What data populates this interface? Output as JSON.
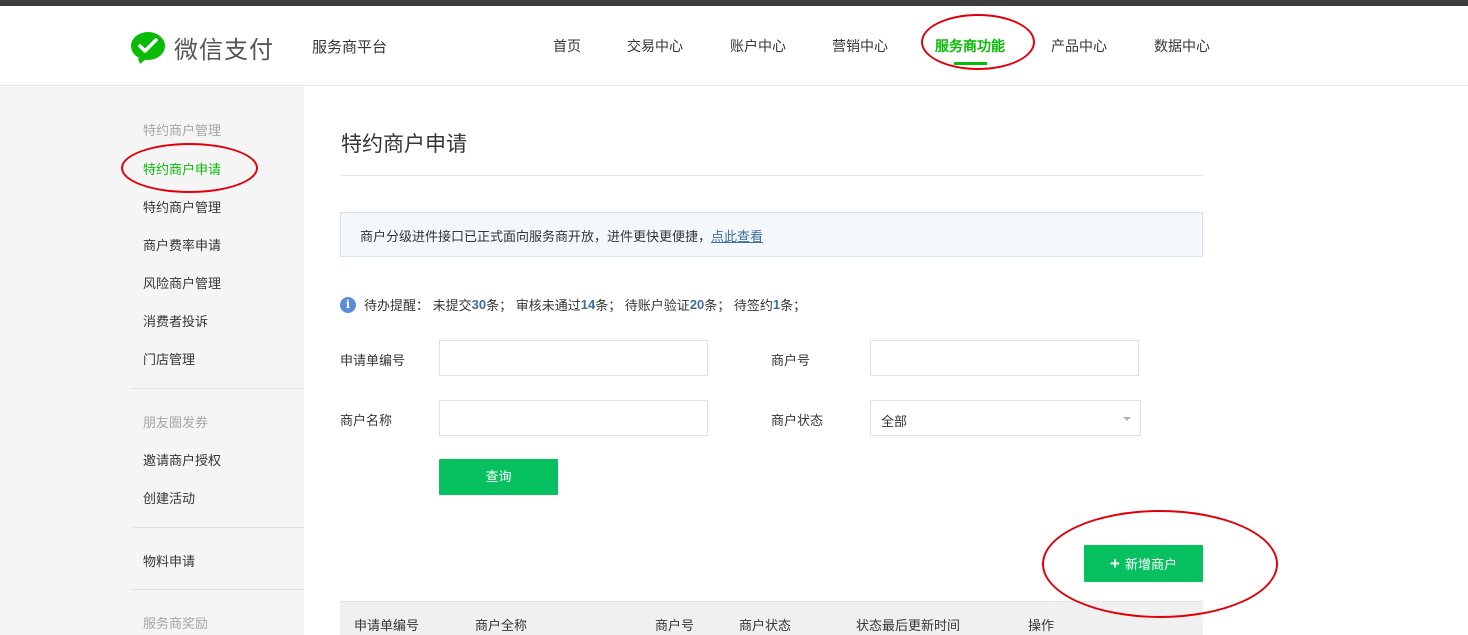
{
  "header": {
    "logo_text": "微信支付",
    "platform": "服务商平台",
    "nav": [
      {
        "label": "首页"
      },
      {
        "label": "交易中心"
      },
      {
        "label": "账户中心"
      },
      {
        "label": "营销中心"
      },
      {
        "label": "服务商功能",
        "active": true
      },
      {
        "label": "产品中心"
      },
      {
        "label": "数据中心"
      }
    ]
  },
  "sidebar": {
    "group1_title": "特约商户管理",
    "group1_items": [
      "特约商户申请",
      "特约商户管理",
      "商户费率申请",
      "风险商户管理",
      "消费者投诉",
      "门店管理"
    ],
    "group2_title": "朋友圈发券",
    "group2_items": [
      "邀请商户授权",
      "创建活动"
    ],
    "group3_items": [
      "物料申请"
    ],
    "group4_title": "服务商奖励"
  },
  "main": {
    "title": "特约商户申请",
    "notice_text": "商户分级进件接口已正式面向服务商开放，进件更快更便捷，",
    "notice_link": "点此查看",
    "todo": {
      "prefix": "待办提醒： 未提交",
      "n1": "30",
      "t1": "条； 审核未通过",
      "n2": "14",
      "t2": "条； 待账户验证",
      "n3": "20",
      "t3": "条； 待签约",
      "n4": "1",
      "t4": "条；"
    },
    "form": {
      "app_no_label": "申请单编号",
      "app_no_value": "",
      "merchant_no_label": "商户号",
      "merchant_no_value": "",
      "merchant_name_label": "商户名称",
      "merchant_name_value": "",
      "status_label": "商户状态",
      "status_value": "全部",
      "query_button": "查询"
    },
    "add_button": "新增商户",
    "table_headers": [
      "申请单编号",
      "商户全称",
      "商户号",
      "商户状态",
      "状态最后更新时间",
      "操作"
    ]
  },
  "colors": {
    "brand_green": "#07c160",
    "active_green": "#09bb07",
    "annotation_red": "#e0000a",
    "link_blue": "#3c6ea3"
  }
}
